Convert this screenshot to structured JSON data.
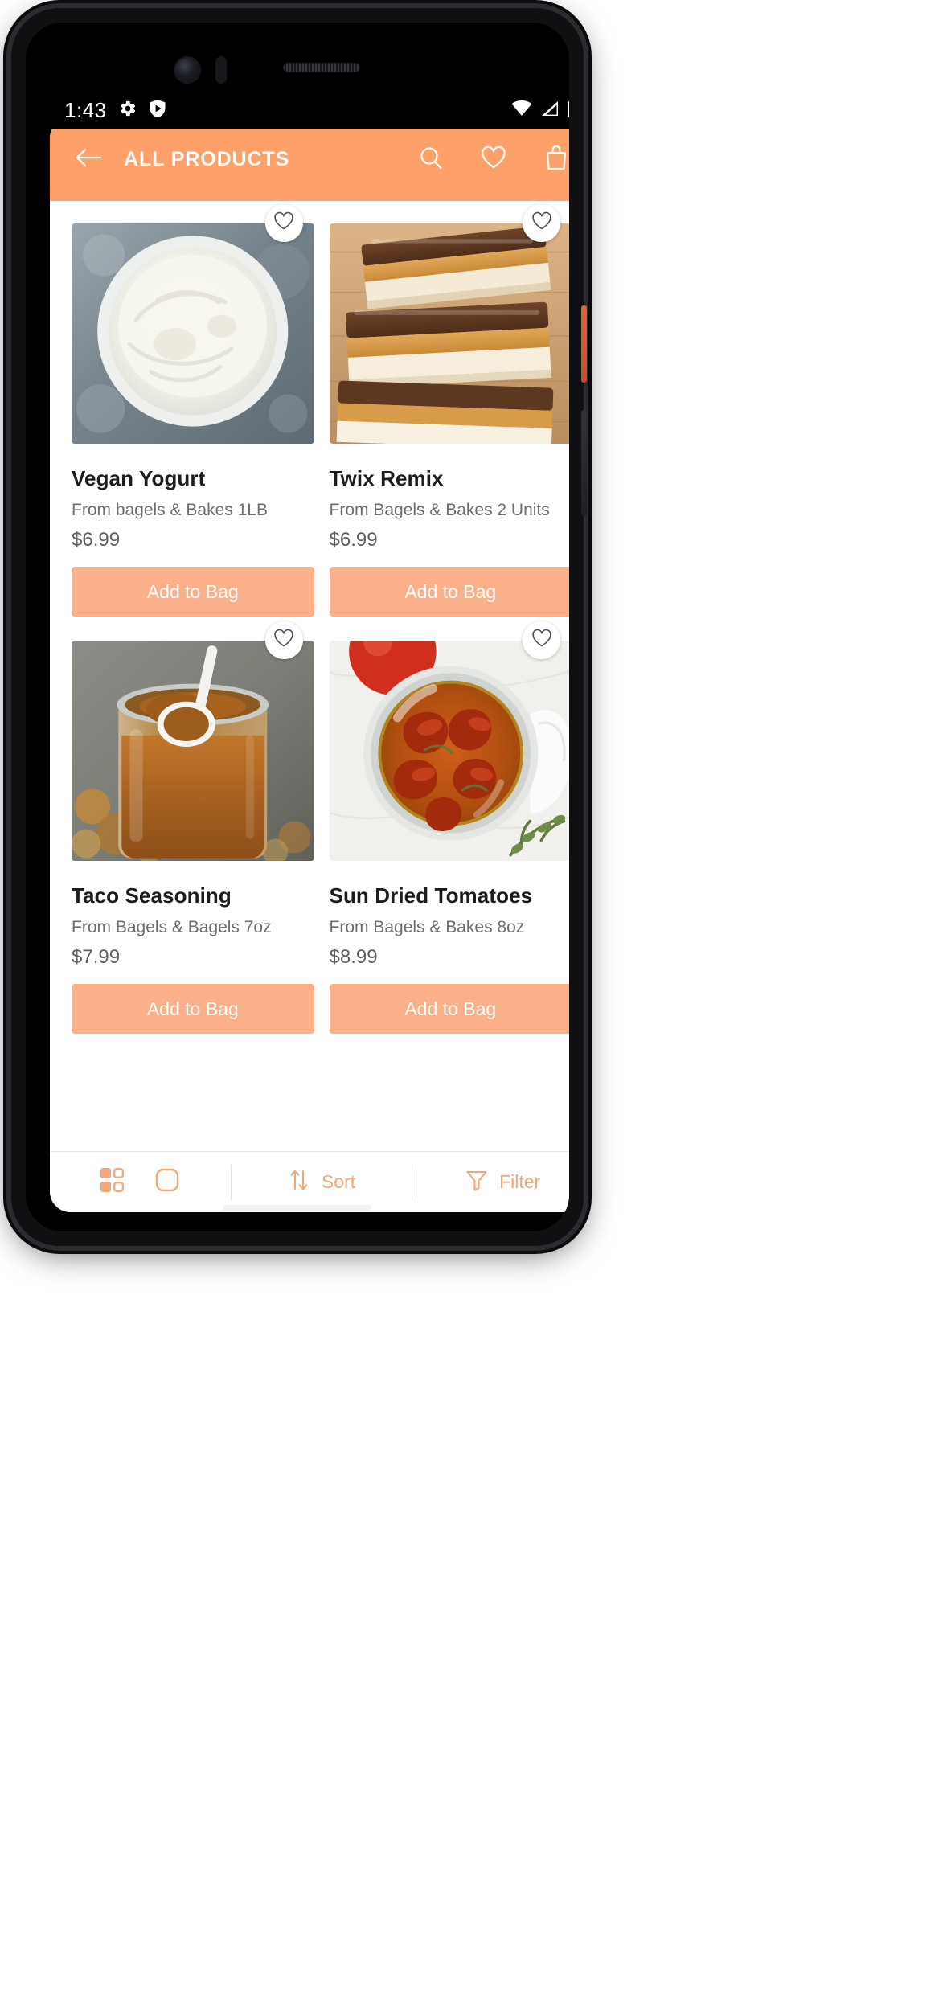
{
  "status_bar": {
    "time": "1:43",
    "left_icons": [
      "gear-icon",
      "shield-play-icon"
    ],
    "right_icons": [
      "wifi-icon",
      "cellular-signal-icon",
      "battery-icon"
    ]
  },
  "app_bar": {
    "title": "ALL PRODUCTS",
    "back_icon": "arrow-left-icon",
    "actions": [
      {
        "name": "search-icon"
      },
      {
        "name": "heart-icon"
      },
      {
        "name": "shopping-bag-icon"
      }
    ],
    "background_color": "#fda06a"
  },
  "products": [
    {
      "name": "Vegan Yogurt",
      "vendor": "From bagels & Bakes 1LB",
      "price": "$6.99",
      "add_label": "Add to Bag",
      "wishlist_icon": "heart-outline-icon",
      "image_alt": "white bowl of vegan yogurt on grey stone"
    },
    {
      "name": "Twix Remix",
      "vendor": "From Bagels & Bakes 2 Units",
      "price": "$6.99",
      "add_label": "Add to Bag",
      "wishlist_icon": "heart-outline-icon",
      "image_alt": "chocolate caramel twix slice bars on wooden board"
    },
    {
      "name": "Taco Seasoning",
      "vendor": "From Bagels & Bagels 7oz",
      "price": "$7.99",
      "add_label": "Add to Bag",
      "wishlist_icon": "heart-outline-icon",
      "image_alt": "glass jar of taco seasoning with spoon"
    },
    {
      "name": "Sun Dried Tomatoes",
      "vendor": "From Bagels & Bakes 8oz",
      "price": "$8.99",
      "add_label": "Add to Bag",
      "wishlist_icon": "heart-outline-icon",
      "image_alt": "jar of sun dried tomatoes in oil with thyme"
    }
  ],
  "bottom_toolbar": {
    "grid_view_icon": "grid-view-icon",
    "list_view_icon": "single-column-view-icon",
    "sort_label": "Sort",
    "sort_icon": "sort-arrows-icon",
    "filter_label": "Filter",
    "filter_icon": "funnel-icon",
    "accent_color": "#f0a678"
  }
}
